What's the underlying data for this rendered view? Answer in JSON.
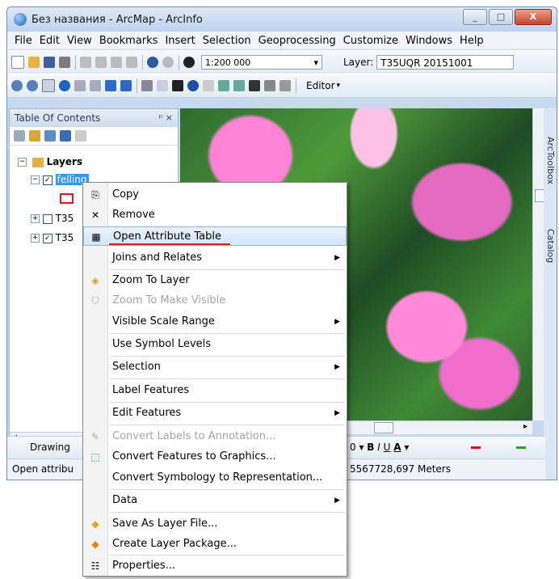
{
  "window": {
    "title": "Без названия - ArcMap - ArcInfo",
    "buttons": [
      "_",
      "□",
      "X"
    ]
  },
  "menubar": [
    "File",
    "Edit",
    "View",
    "Bookmarks",
    "Insert",
    "Selection",
    "Geoprocessing",
    "Customize",
    "Windows",
    "Help"
  ],
  "toolbar": {
    "scale": "1:200 000",
    "layer_label": "Layer:",
    "layer_value": "T35UQR 20151001",
    "editor_label": "Editor"
  },
  "toc": {
    "title": "Table Of Contents",
    "controls": "ᵖ ×",
    "root": "Layers",
    "layers": [
      "felling",
      "T35",
      "T35"
    ]
  },
  "side_tabs": [
    "ArcToolbox",
    "Catalog"
  ],
  "drawing_label": "Drawing",
  "status": {
    "left": "Open attribu",
    "coords": "5567728,697 Meters"
  },
  "context_menu": {
    "items": [
      {
        "label": "Copy",
        "icon": "copy-icon",
        "disabled": false,
        "submenu": false
      },
      {
        "label": "Remove",
        "icon": "remove-icon",
        "disabled": false,
        "submenu": false
      },
      {
        "label": "Open Attribute Table",
        "icon": "table-icon",
        "disabled": false,
        "submenu": false,
        "highlighted": true
      },
      {
        "label": "Joins and Relates",
        "icon": "",
        "disabled": false,
        "submenu": true
      },
      {
        "label": "Zoom To Layer",
        "icon": "zoom-layer-icon",
        "disabled": false,
        "submenu": false
      },
      {
        "label": "Zoom To Make Visible",
        "icon": "zoom-visible-icon",
        "disabled": true,
        "submenu": false
      },
      {
        "label": "Visible Scale Range",
        "icon": "",
        "disabled": false,
        "submenu": true
      },
      {
        "label": "Use Symbol Levels",
        "icon": "",
        "disabled": false,
        "submenu": false
      },
      {
        "label": "Selection",
        "icon": "",
        "disabled": false,
        "submenu": true
      },
      {
        "label": "Label Features",
        "icon": "",
        "disabled": false,
        "submenu": false
      },
      {
        "label": "Edit Features",
        "icon": "",
        "disabled": false,
        "submenu": true
      },
      {
        "label": "Convert Labels to Annotation...",
        "icon": "annotation-icon",
        "disabled": true,
        "submenu": false
      },
      {
        "label": "Convert Features to Graphics...",
        "icon": "graphics-icon",
        "disabled": false,
        "submenu": false
      },
      {
        "label": "Convert Symbology to Representation...",
        "icon": "",
        "disabled": false,
        "submenu": false
      },
      {
        "label": "Data",
        "icon": "",
        "disabled": false,
        "submenu": true
      },
      {
        "label": "Save As Layer File...",
        "icon": "save-layer-icon",
        "disabled": false,
        "submenu": false
      },
      {
        "label": "Create Layer Package...",
        "icon": "package-icon",
        "disabled": false,
        "submenu": false
      },
      {
        "label": "Properties...",
        "icon": "properties-icon",
        "disabled": false,
        "submenu": false
      }
    ]
  },
  "colors": {
    "highlight_underline": "#e21b1b",
    "selection_blue": "#3399ff"
  }
}
